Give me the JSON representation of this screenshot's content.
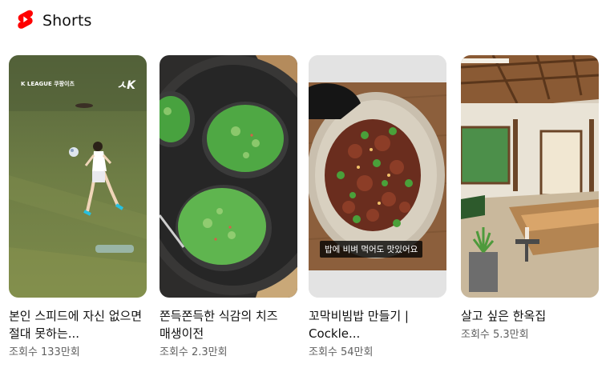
{
  "shelf": {
    "title": "Shorts",
    "icon": "youtube-shorts-icon",
    "accent_color": "#ff0000"
  },
  "shorts": [
    {
      "title": "본인 스피드에 자신 없으면 절대 못하는...",
      "views": "조회수 133만회",
      "overlay_logo_text": "K LEAGUE 쿠팡이츠",
      "overlay_badge": "ㅅK"
    },
    {
      "title": "쫀득쫀득한 식감의 치즈 매생이전",
      "views": "조회수 2.3만회"
    },
    {
      "title": "꼬막비빔밥 만들기 | Cockle...",
      "views": "조회수 54만회",
      "caption": "밥에 비벼 먹어도 맛있어요"
    },
    {
      "title": "살고 싶은 한옥집",
      "views": "조회수 5.3만회"
    }
  ]
}
